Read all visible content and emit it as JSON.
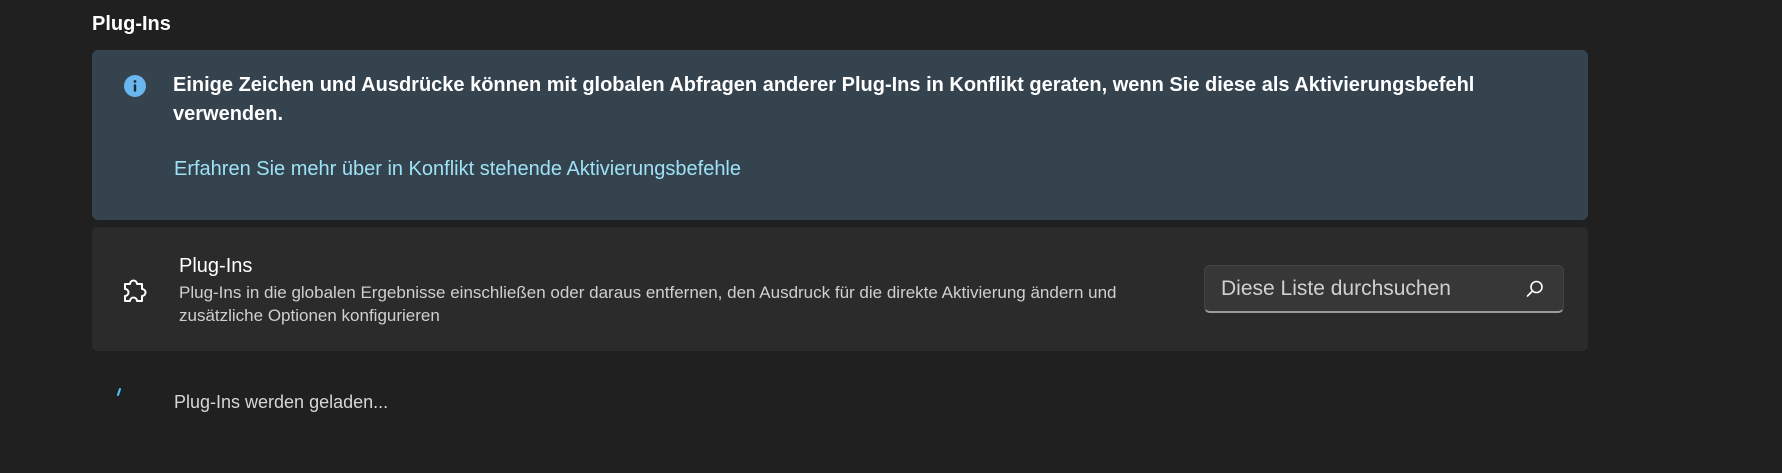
{
  "section": {
    "title": "Plug-Ins"
  },
  "infobar": {
    "icon": "info-icon",
    "message": "Einige Zeichen und Ausdrücke können mit globalen Abfragen anderer Plug-Ins in Konflikt geraten, wenn Sie diese als Aktivierungsbefehl verwenden.",
    "link_text": "Erfahren Sie mehr über in Konflikt stehende Aktivierungsbefehle",
    "background_color": "#35434f",
    "link_color": "#9ee1f5"
  },
  "plugins_card": {
    "icon": "puzzle-icon",
    "title": "Plug-Ins",
    "description": "Plug-Ins in die globalen Ergebnisse einschließen oder daraus entfernen, den Ausdruck für die direkte Aktivierung ändern und zusätzliche Optionen konfigurieren",
    "search": {
      "placeholder": "Diese Liste durchsuchen",
      "value": "",
      "icon": "search-icon"
    }
  },
  "loading": {
    "icon": "spinner-icon",
    "text": "Plug-Ins werden geladen...",
    "accent_color": "#4cc2ff"
  }
}
